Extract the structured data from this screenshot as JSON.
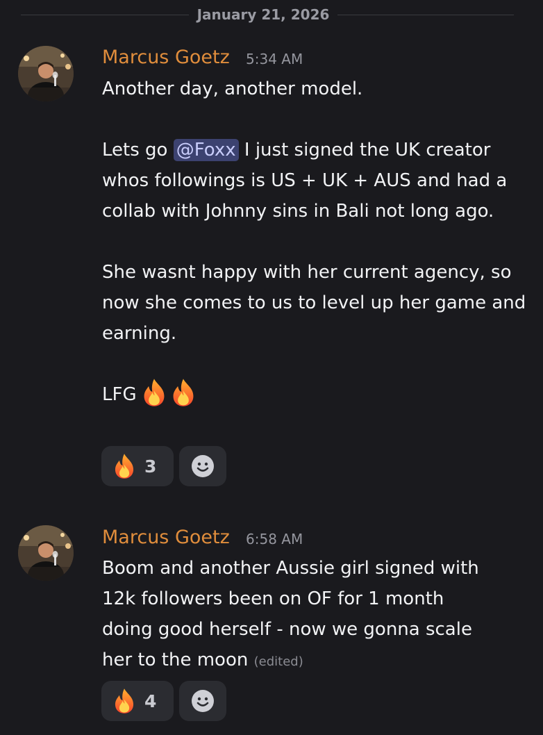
{
  "date_divider": "January 21, 2026",
  "messages": [
    {
      "author": "Marcus Goetz",
      "timestamp": "5:34 AM",
      "line1": "Another day, another model.",
      "p2_before": "Lets go ",
      "mention": "@Foxx",
      "p2_after": " I just signed the UK creator whos followings is US + UK + AUS and had a collab with Johnny sins in Bali not long ago.",
      "p3": "She wasnt happy with her current agency, so now she comes to us to level up her game and earning.",
      "p4": "LFG",
      "reaction": {
        "icon": "fire-icon",
        "count": "3"
      }
    },
    {
      "author": "Marcus Goetz",
      "timestamp": "6:58 AM",
      "text": "Boom and another Aussie girl signed with 12k followers been on OF for 1 month doing good herself - now we gonna scale her to the moon",
      "edited": "(edited)",
      "reaction": {
        "icon": "fire-icon",
        "count": "4"
      }
    }
  ],
  "colors": {
    "background": "#1a1a1e",
    "username": "#e08d3c",
    "mention_bg": "#3c4270",
    "reaction_bg": "#2b2c31"
  }
}
